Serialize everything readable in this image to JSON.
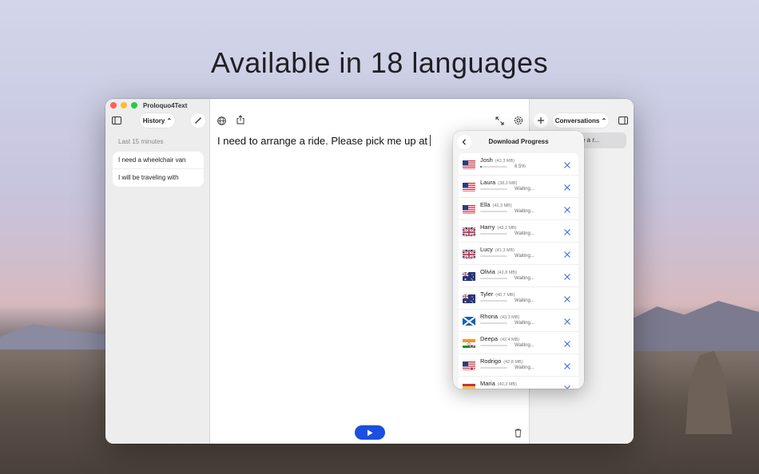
{
  "headline": "Available in 18 languages",
  "window": {
    "app_title": "Proloquo4Text",
    "history_label": "History ⌃",
    "section_label": "Last 15 minutes",
    "history_items": [
      "I need a wheelchair van",
      "I will be traveling with"
    ],
    "editor_text": "I need to arrange a ride. Please pick me up at",
    "conversations_label": "Conversations ⌃",
    "conversation_preview": "e a r..."
  },
  "popover": {
    "title": "Download Progress",
    "voices": [
      {
        "name": "Josh",
        "size": "(42,3 MB)",
        "status": "6.5%",
        "progress": 0.065,
        "flag": "us"
      },
      {
        "name": "Laura",
        "size": "(38,0 MB)",
        "status": "Waiting...",
        "progress": 0,
        "flag": "us"
      },
      {
        "name": "Ella",
        "size": "(42,3 MB)",
        "status": "Waiting...",
        "progress": 0,
        "flag": "us"
      },
      {
        "name": "Harry",
        "size": "(43,2 MB)",
        "status": "Waiting...",
        "progress": 0,
        "flag": "uk"
      },
      {
        "name": "Lucy",
        "size": "(41,3 MB)",
        "status": "Waiting...",
        "progress": 0,
        "flag": "uk"
      },
      {
        "name": "Olivia",
        "size": "(42,8 MB)",
        "status": "Waiting...",
        "progress": 0,
        "flag": "au"
      },
      {
        "name": "Tyler",
        "size": "(40,7 MB)",
        "status": "Waiting...",
        "progress": 0,
        "flag": "au"
      },
      {
        "name": "Rhona",
        "size": "(43,3 MB)",
        "status": "Waiting...",
        "progress": 0,
        "flag": "scotland"
      },
      {
        "name": "Deepa",
        "size": "(42,4 MB)",
        "status": "Waiting...",
        "progress": 0,
        "flag": "in"
      },
      {
        "name": "Rodrigo",
        "size": "(42,8 MB)",
        "status": "Waiting...",
        "progress": 0,
        "flag": "us-es"
      },
      {
        "name": "Maria",
        "size": "(40,3 MB)",
        "status": "",
        "progress": 0,
        "flag": "es"
      }
    ]
  },
  "colors": {
    "accent": "#1a4fe0",
    "cancel": "#3b6fd8"
  }
}
